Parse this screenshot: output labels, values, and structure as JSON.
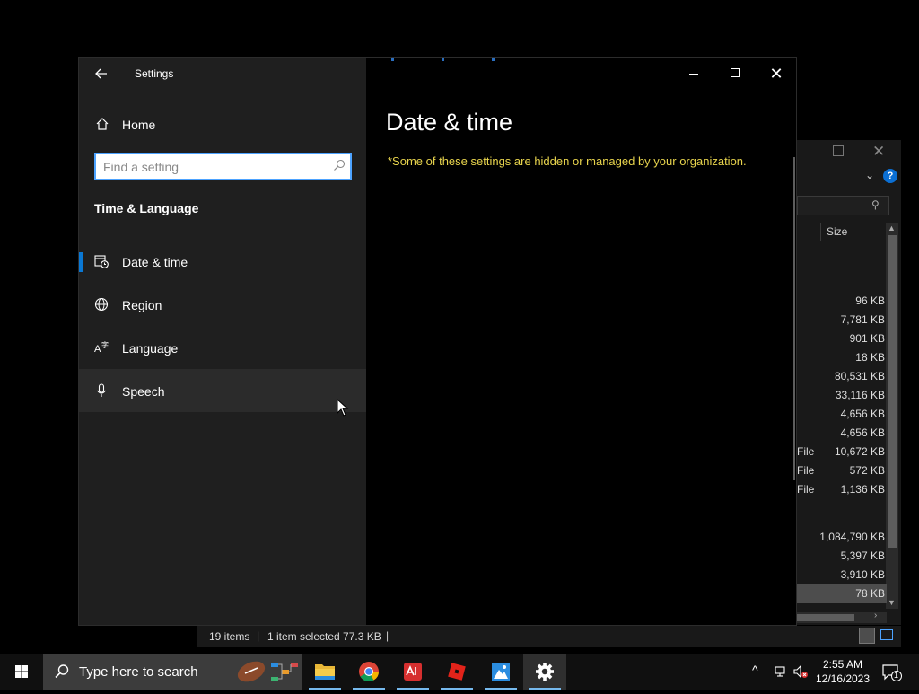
{
  "settings_window": {
    "title": "Settings",
    "home_label": "Home",
    "search_placeholder": "Find a setting",
    "section_title": "Time & Language",
    "nav_items": [
      {
        "label": "Date & time",
        "icon": "date-time-icon",
        "selected": true
      },
      {
        "label": "Region",
        "icon": "globe-icon",
        "selected": false
      },
      {
        "label": "Language",
        "icon": "language-icon",
        "selected": false
      },
      {
        "label": "Speech",
        "icon": "microphone-icon",
        "selected": false
      }
    ],
    "content_title": "Date & time",
    "managed_note": "*Some of these settings are hidden or managed by your organization.",
    "accent_color": "#0a78d4",
    "note_color": "#e8d44d"
  },
  "explorer": {
    "column_size": "Size",
    "rows": [
      {
        "type": "",
        "size": "96 KB"
      },
      {
        "type": "",
        "size": "7,781 KB"
      },
      {
        "type": "",
        "size": "901 KB"
      },
      {
        "type": "",
        "size": "18 KB"
      },
      {
        "type": "",
        "size": "80,531 KB"
      },
      {
        "type": "",
        "size": "33,116 KB"
      },
      {
        "type": "",
        "size": "4,656 KB"
      },
      {
        "type": "",
        "size": "4,656 KB"
      },
      {
        "type": "File",
        "size": "10,672 KB"
      },
      {
        "type": "File",
        "size": "572 KB"
      },
      {
        "type": "File",
        "size": "1,136 KB"
      },
      {
        "type": "",
        "size": "1,084,790 KB"
      },
      {
        "type": "",
        "size": "5,397 KB"
      },
      {
        "type": "",
        "size": "3,910 KB"
      },
      {
        "type": "",
        "size": "78 KB"
      }
    ],
    "status_items": "19 items",
    "status_selected": "1 item selected  77.3 KB"
  },
  "taskbar": {
    "search_placeholder": "Type here to search",
    "apps": [
      "file-explorer-icon",
      "chrome-icon",
      "anydesk-icon",
      "roblox-icon",
      "paint-icon",
      "settings-gear-icon"
    ],
    "time": "2:55 AM",
    "date": "12/16/2023",
    "notification_count": "1"
  }
}
